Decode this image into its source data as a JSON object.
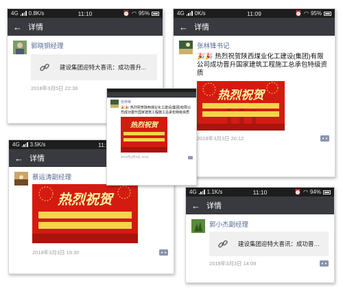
{
  "cards": {
    "c1": {
      "status": {
        "signal": "4G",
        "speed": "0.8K/s",
        "time": "11:10",
        "battery": "95%"
      },
      "nav": {
        "back": "←",
        "title": "详情"
      },
      "author": "郭晓铜经理",
      "link_text": "建设集团迎特大喜讯：成功晋升...",
      "timestamp": "2018年3月5日 22:36"
    },
    "c2": {
      "status": {
        "signal": "4G",
        "speed": "0K/s",
        "time": "11:09",
        "battery": "95%"
      },
      "nav": {
        "back": "←",
        "title": "详情"
      },
      "author": "张林锋书记",
      "emoji": "🎉🎉",
      "post_text": "热烈祝贺陕西煤业化工建设(集团)有限公司成功晋升国家建筑工程施工总承包特级资质",
      "banner_title": "热烈祝贺",
      "timestamp": "2018年3月3日 20:12"
    },
    "c3": {
      "status": {
        "signal": "4G",
        "speed": "3.5K/s",
        "time": "11:11"
      },
      "nav": {
        "back": "←",
        "title": "详情"
      },
      "author": "蔡运涛副经理",
      "banner_title": "热烈祝贺",
      "timestamp": "2018年3月3日 19:30"
    },
    "c4": {
      "author": "张林锋",
      "emoji": "🎉🎉",
      "post_text": "热烈祝贺陕西煤业化工建设(集团)有限公司成功晋升国家建筑工程施工总承包特级资质",
      "banner_title": "热烈祝贺",
      "timestamp": "2018年3月3日 19:31"
    },
    "c5": {
      "status": {
        "signal": "4G",
        "speed": "1.1K/s",
        "time": "11:10",
        "battery": "94%"
      },
      "nav": {
        "back": "←",
        "title": "详情"
      },
      "author": "郭小杰副经理",
      "link_text": "建设集团迎特大喜讯：成功晋升...",
      "timestamp": "2018年3月3日 14:09"
    }
  },
  "colors": {
    "status_bar": "#1d1d1d",
    "nav_bar": "#393a3f",
    "author_link": "#576b95",
    "timestamp": "#9a9a9a",
    "banner_red": "#d41b12",
    "banner_gold": "#f6d44a"
  },
  "icons": {
    "back": "arrow-left-icon",
    "link": "chain-link-icon",
    "comment": "comment-bubble-icon",
    "wifi": "wifi-icon",
    "alarm": "alarm-icon",
    "battery": "battery-icon"
  }
}
